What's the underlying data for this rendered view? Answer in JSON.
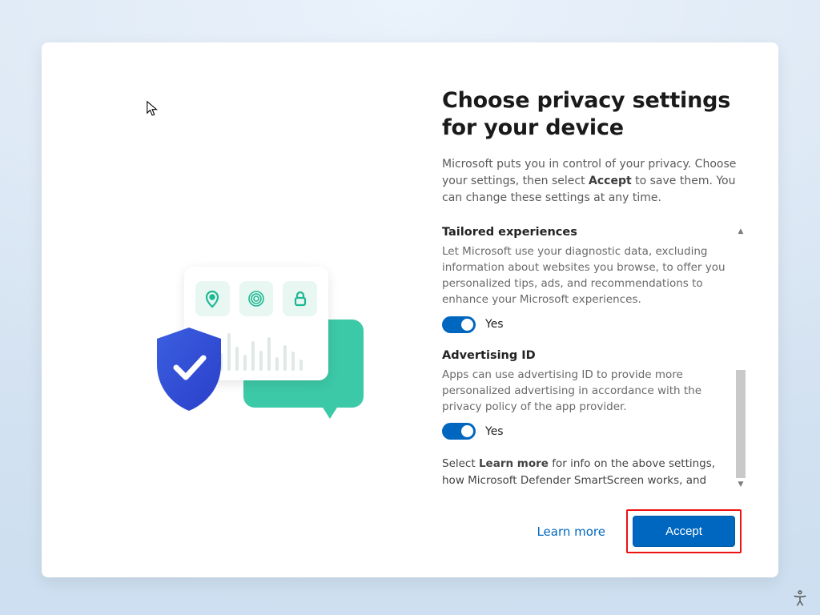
{
  "title": "Choose privacy settings for your device",
  "intro_pre": "Microsoft puts you in control of your privacy. Choose your settings, then select ",
  "intro_bold": "Accept",
  "intro_post": " to save them. You can change these settings at any time.",
  "sections": [
    {
      "heading": "Tailored experiences",
      "body": "Let Microsoft use your diagnostic data, excluding information about websites you browse, to offer you personalized tips, ads, and recommendations to enhance your Microsoft experiences.",
      "toggle_on": true,
      "toggle_label": "Yes"
    },
    {
      "heading": "Advertising ID",
      "body": "Apps can use advertising ID to provide more personalized advertising in accordance with the privacy policy of the app provider.",
      "toggle_on": true,
      "toggle_label": "Yes"
    }
  ],
  "footer_pre": "Select ",
  "footer_bold": "Learn more",
  "footer_post": " for info on the above settings, how Microsoft Defender SmartScreen works, and the related data transfers and uses.",
  "learn_more": "Learn more",
  "accept": "Accept",
  "icons": {
    "shield": "shield-check-icon",
    "pin": "map-pin-icon",
    "fingerprint": "fingerprint-icon",
    "lock": "lock-icon",
    "accessibility": "accessibility-icon",
    "cursor": "mouse-cursor-icon"
  },
  "colors": {
    "accent": "#0067c0",
    "teal": "#3cc9a7",
    "highlight_border": "#e11"
  }
}
